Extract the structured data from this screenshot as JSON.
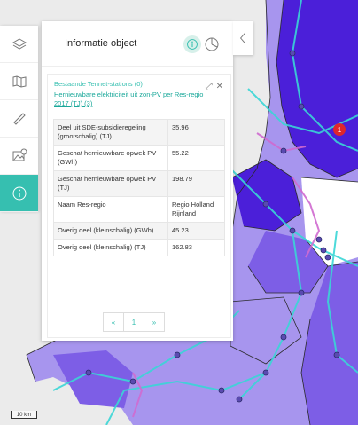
{
  "panel": {
    "title": "Informatie object"
  },
  "card": {
    "layer_sub": "Bestaande Tennet-stations (0)",
    "layer_link": "Hernieuwbare elektriciteit uit zon-PV per Res-regio 2017 (TJ) (3)",
    "rows": [
      {
        "label": "Deel uit SDE-subsidieregeling (grootschalig) (TJ)",
        "value": "35.96"
      },
      {
        "label": "Geschat hernieuwbare opwek PV (GWh)",
        "value": "55.22"
      },
      {
        "label": "Geschat hernieuwbare opwek PV (TJ)",
        "value": "198.79"
      },
      {
        "label": "Naam Res-regio",
        "value": "Regio Holland Rijnland"
      },
      {
        "label": "Overig deel (kleinschalig) (GWh)",
        "value": "45.23"
      },
      {
        "label": "Overig deel (kleinschalig) (TJ)",
        "value": "162.83"
      }
    ]
  },
  "pager": {
    "prev": "«",
    "page": "1",
    "next": "»"
  },
  "map": {
    "badge": "1",
    "scale_label": "10 km"
  },
  "colors": {
    "accent": "#36bfb0",
    "region_dark": "#4b1fd9",
    "region_mid": "#7d5ee6",
    "region_light": "#a795ee",
    "lines": "#3ad6d6"
  },
  "icons": [
    "layers-icon",
    "map-book-icon",
    "ruler-icon",
    "image-add-icon",
    "info-icon",
    "pie-chart-icon",
    "chevron-left-icon",
    "resize-icon",
    "close-icon"
  ]
}
